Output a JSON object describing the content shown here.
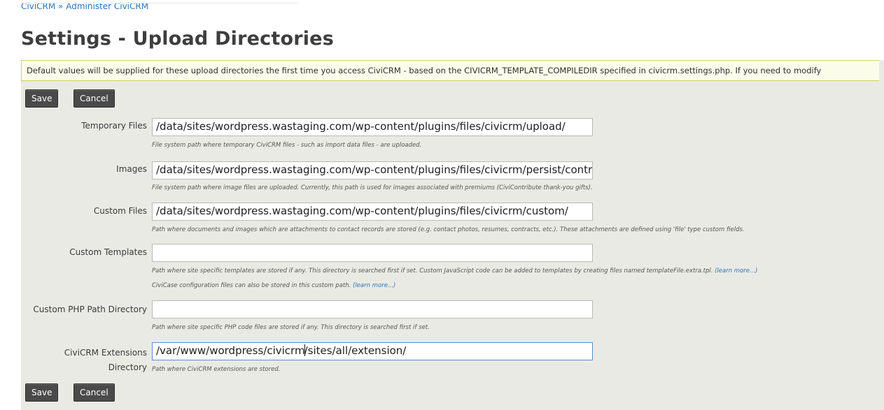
{
  "breadcrumb": {
    "root": "CiviCRM",
    "separator": " » ",
    "current": "Administer CiviCRM"
  },
  "page": {
    "title": "Settings - Upload Directories"
  },
  "help": {
    "text": "Default values will be supplied for these upload directories the first time you access CiviCRM - based on the CIVICRM_TEMPLATE_COMPILEDIR specified in civicrm.settings.php. If you need to modify"
  },
  "buttons": {
    "save": "Save",
    "cancel": "Cancel"
  },
  "fields": {
    "temp": {
      "label": "Temporary Files",
      "value": "/data/sites/wordpress.wastaging.com/wp-content/plugins/files/civicrm/upload/",
      "desc": "File system path where temporary CiviCRM files - such as import data files - are uploaded."
    },
    "images": {
      "label": "Images",
      "value": "/data/sites/wordpress.wastaging.com/wp-content/plugins/files/civicrm/persist/contri",
      "desc": "File system path where image files are uploaded. Currently, this path is used for images associated with premiums (CiviContribute thank-you gifts)."
    },
    "custom_files": {
      "label": "Custom Files",
      "value": "/data/sites/wordpress.wastaging.com/wp-content/plugins/files/civicrm/custom/",
      "desc": "Path where documents and images which are attachments to contact records are stored (e.g. contact photos, resumes, contracts, etc.). These attachments are defined using 'file' type custom fields."
    },
    "custom_templates": {
      "label": "Custom Templates",
      "value": "",
      "desc": "Path where site specific templates are stored if any. This directory is searched first if set. Custom JavaScript code can be added to templates by creating files named templateFile.extra.tpl.",
      "desc_link": "(learn more...)",
      "desc2": "CiviCase configuration files can also be stored in this custom path.",
      "desc2_link": "(learn more...)"
    },
    "custom_php": {
      "label": "Custom PHP Path Directory",
      "value": "",
      "desc": "Path where site specific PHP code files are stored if any. This directory is searched first if set."
    },
    "extensions": {
      "label_line1": "CiviCRM Extensions",
      "label_line2": "Directory",
      "value_before_caret": "/var/www/wordpress/civicrm",
      "value_after_caret": "/sites/all/extension/",
      "desc": "Path where CiviCRM extensions are stored."
    }
  }
}
